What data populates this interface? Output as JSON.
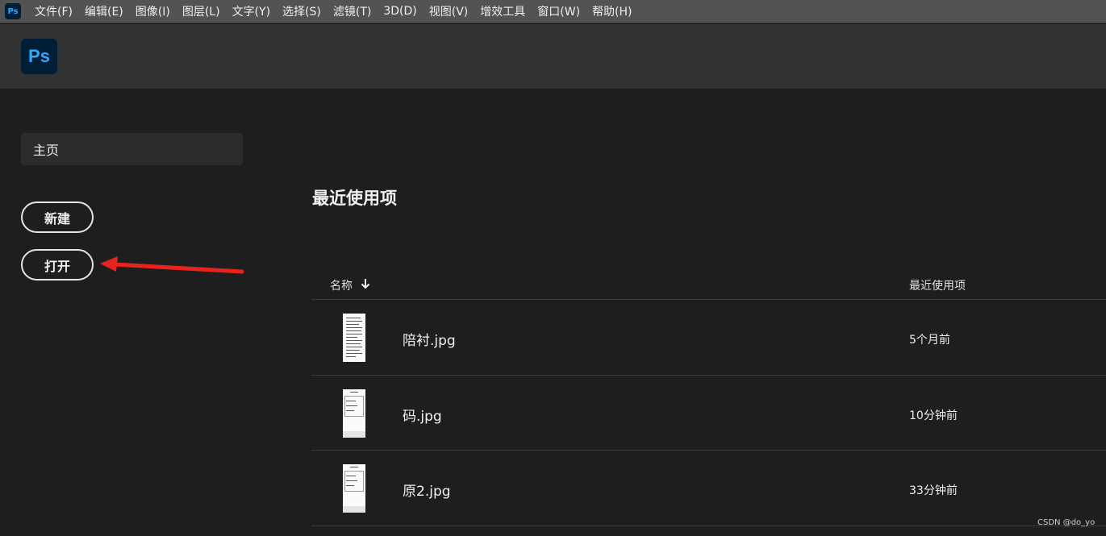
{
  "menubar": {
    "logo_text": "Ps",
    "items": [
      "文件(F)",
      "编辑(E)",
      "图像(I)",
      "图层(L)",
      "文字(Y)",
      "选择(S)",
      "滤镜(T)",
      "3D(D)",
      "视图(V)",
      "增效工具",
      "窗口(W)",
      "帮助(H)"
    ]
  },
  "header": {
    "logo_text": "Ps"
  },
  "sidebar": {
    "home_label": "主页",
    "new_label": "新建",
    "open_label": "打开"
  },
  "main": {
    "section_title": "最近使用项",
    "columns": {
      "name": "名称",
      "recent": "最近使用项"
    },
    "files": [
      {
        "name": "陪衬.jpg",
        "time": "5个月前"
      },
      {
        "name": "码.jpg",
        "time": "10分钟前"
      },
      {
        "name": "原2.jpg",
        "time": "33分钟前"
      }
    ]
  },
  "annotation": {
    "arrow_color": "#e8231c",
    "icon": "red-arrow-icon"
  },
  "colors": {
    "ps_blue": "#31a8ff",
    "ps_dark": "#001e36",
    "background": "#1e1e1e"
  },
  "watermark": "CSDN @do_yo"
}
